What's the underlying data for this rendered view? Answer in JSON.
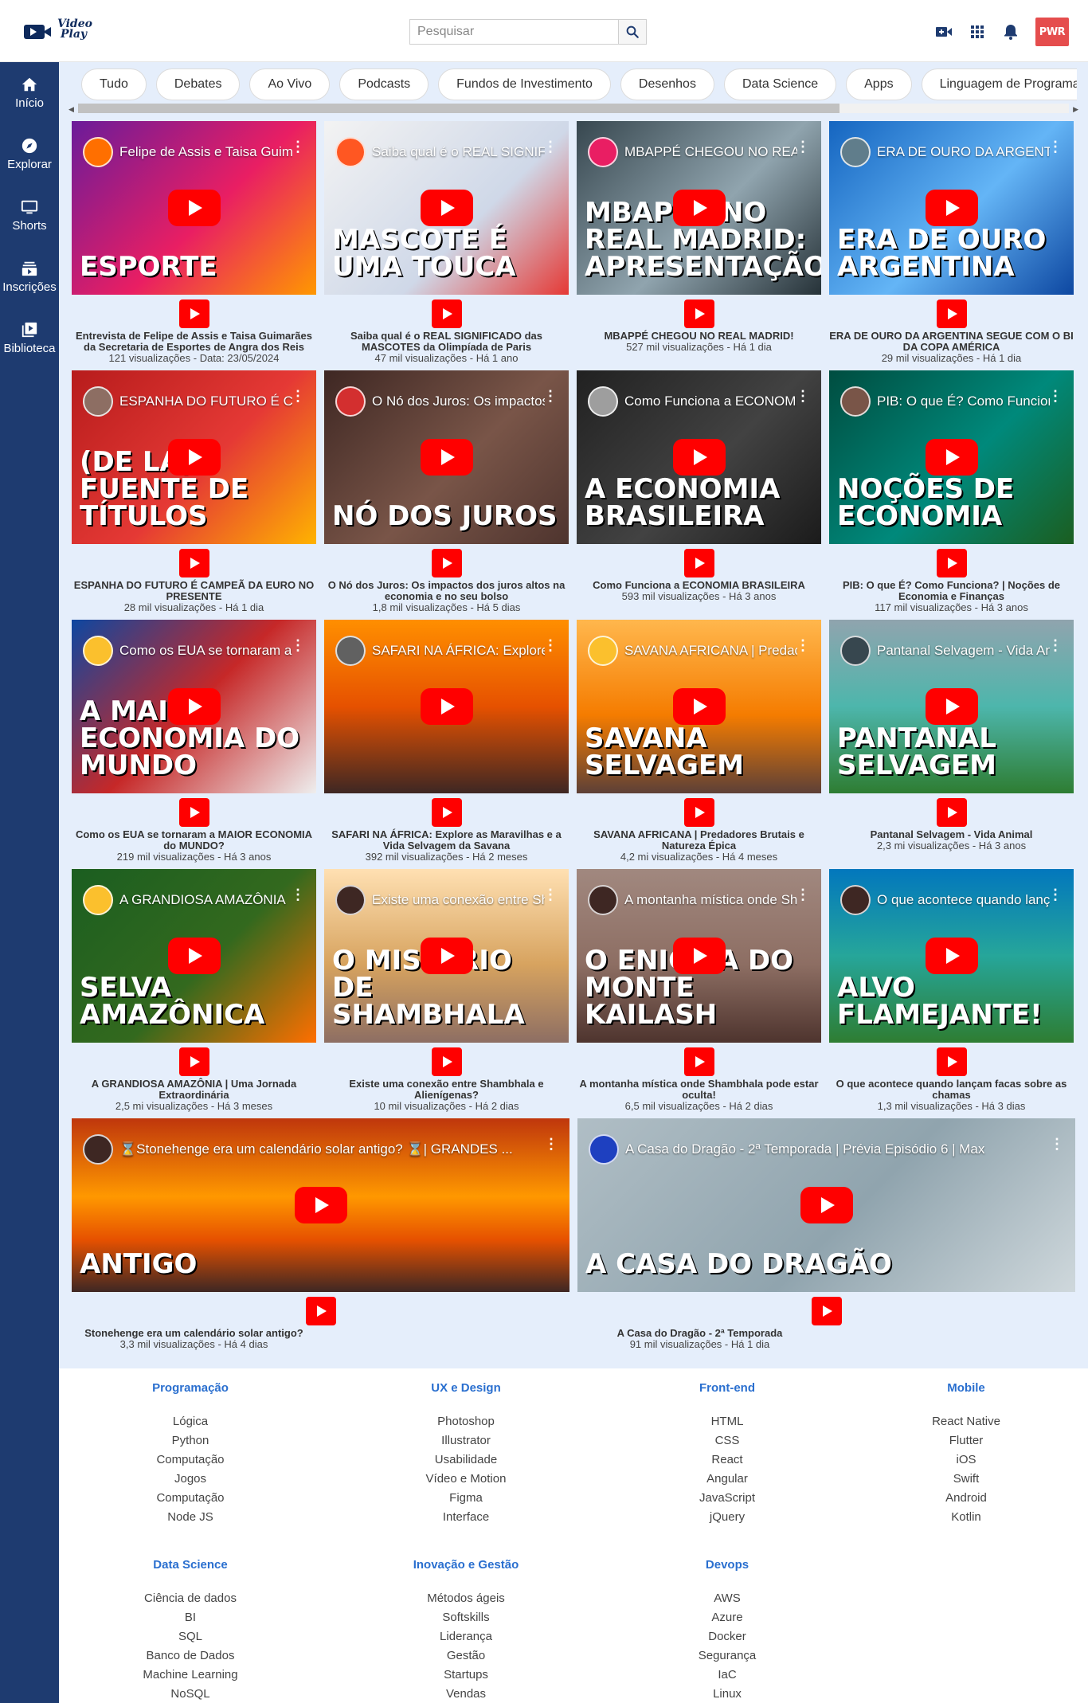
{
  "header": {
    "logo_line1": "Video",
    "logo_line2": "Play",
    "search_placeholder": "Pesquisar",
    "avatar_text": "PWR"
  },
  "sidebar": [
    {
      "label": "Início",
      "icon": "home-icon"
    },
    {
      "label": "Explorar",
      "icon": "compass-icon"
    },
    {
      "label": "Shorts",
      "icon": "shorts-icon"
    },
    {
      "label": "Inscrições",
      "icon": "subscriptions-icon"
    },
    {
      "label": "Biblioteca",
      "icon": "library-icon"
    }
  ],
  "chips": [
    "Tudo",
    "Debates",
    "Ao Vivo",
    "Podcasts",
    "Fundos de Investimento",
    "Desenhos",
    "Data Science",
    "Apps",
    "Linguagem de Programação"
  ],
  "videos": [
    {
      "thumb_title": "Felipe de Assis e Taisa Guimarães | Entrevista",
      "thumb_text": "ESPORTE",
      "title": "Entrevista de Felipe de Assis e Taisa Guimarães da Secretaria de Esportes de Angra dos Reis",
      "views": "121 visualizações - Data: 23/05/2024",
      "bg": "linear-gradient(135deg,#6a1b9a,#e91e63 55%,#ff9800)",
      "chan": "#ff6f00"
    },
    {
      "thumb_title": "Saiba qual é o REAL SIGNIFICADO",
      "thumb_text": "MASCOTE É UMA TOUCA",
      "title": "Saiba qual é o REAL SIGNIFICADO das MASCOTES da Olimpíada de Paris",
      "views": "47 mil visualizações - Há 1 ano",
      "bg": "linear-gradient(135deg,#f3f3f3,#cfd8e8 60%,#e53935)",
      "chan": "#ff5722"
    },
    {
      "thumb_title": "MBAPPÉ CHEGOU NO REAL MADRID!",
      "thumb_text": "MBAPPÉ NO REAL MADRID: APRESENTAÇÃO",
      "title": "MBAPPÉ CHEGOU NO REAL MADRID!",
      "views": "527 mil visualizações - Há 1 dia",
      "bg": "linear-gradient(135deg,#37474f,#90a4ae 55%,#263238)",
      "chan": "#e91e63"
    },
    {
      "thumb_title": "ERA DE OURO DA ARGENTINA",
      "thumb_text": "ERA DE OURO ARGENTINA",
      "title": "ERA DE OURO DA ARGENTINA SEGUE COM O BI DA COPA AMÉRICA",
      "views": "29 mil visualizações - Há 1 dia",
      "bg": "linear-gradient(135deg,#1565c0,#64b5f6 55%,#0d47a1)",
      "chan": "#607d8b"
    },
    {
      "thumb_title": "ESPANHA DO FUTURO É CAMPEÃ",
      "thumb_text": "(DE LA) FUENTE DE TÍTULOS",
      "title": "ESPANHA DO FUTURO É CAMPEÃ DA EURO NO PRESENTE",
      "views": "28 mil visualizações - Há 1 dia",
      "bg": "linear-gradient(135deg,#b71c1c,#e53935 55%,#ffb300)",
      "chan": "#8d6e63"
    },
    {
      "thumb_title": "O Nó dos Juros: Os impactos",
      "thumb_text": "NÓ DOS JUROS",
      "title": "O Nó dos Juros: Os impactos dos juros altos na economia e no seu bolso",
      "views": "1,8 mil visualizações - Há 5 dias",
      "bg": "linear-gradient(135deg,#3e2723,#795548 55%,#4e342e)",
      "chan": "#d32f2f"
    },
    {
      "thumb_title": "Como Funciona a ECONOMIA",
      "thumb_text": "A ECONOMIA BRASILEIRA",
      "title": "Como Funciona a ECONOMIA BRASILEIRA",
      "views": "593 mil visualizações - Há 3 anos",
      "bg": "linear-gradient(135deg,#212121,#424242 55%,#1b1b1b)",
      "chan": "#9e9e9e"
    },
    {
      "thumb_title": "PIB: O que É? Como Funciona?",
      "thumb_text": "NOÇÕES DE ECONOMIA",
      "title": "PIB: O que É? Como Funciona? | Noções de Economia e Finanças",
      "views": "117 mil visualizações - Há 3 anos",
      "bg": "linear-gradient(135deg,#004d40,#00897b 55%,#1b5e20)",
      "chan": "#795548"
    },
    {
      "thumb_title": "Como os EUA se tornaram a MAIOR",
      "thumb_text": "A MAIOR ECONOMIA DO MUNDO",
      "title": "Como os EUA se tornaram a MAIOR ECONOMIA do MUNDO?",
      "views": "219 mil visualizações - Há 3 anos",
      "bg": "linear-gradient(135deg,#0d47a1,#c62828 50%,#eeeeee)",
      "chan": "#fbc02d"
    },
    {
      "thumb_title": "SAFARI NA ÁFRICA: Explore",
      "thumb_text": "",
      "title": "SAFARI NA ÁFRICA: Explore as Maravilhas e a Vida Selvagem da Savana",
      "views": "392 mil visualizações - Há 2 meses",
      "bg": "linear-gradient(180deg,#ff8f00,#e65100 50%,#3e2723)",
      "chan": "#616161"
    },
    {
      "thumb_title": "SAVANA AFRICANA | Predadores",
      "thumb_text": "SAVANA SELVAGEM",
      "title": "SAVANA AFRICANA | Predadores Brutais e Natureza Épica",
      "views": "4,2 mi visualizações - Há 4 meses",
      "bg": "linear-gradient(180deg,#ffb74d,#f57c00 55%,#5d4037)",
      "chan": "#fbc02d"
    },
    {
      "thumb_title": "Pantanal Selvagem - Vida Animal",
      "thumb_text": "PANTANAL SELVAGEM",
      "title": "Pantanal Selvagem - Vida Animal",
      "views": "2,3 mi visualizações - Há 3 anos",
      "bg": "linear-gradient(180deg,#90a4ae,#4db6ac 50%,#2e7d32)",
      "chan": "#37474f"
    },
    {
      "thumb_title": "A GRANDIOSA AMAZÔNIA",
      "thumb_text": "SELVA AMAZÔNICA",
      "title": "A GRANDIOSA AMAZÔNIA | Uma Jornada Extraordinária",
      "views": "2,5 mi visualizações - Há 3 meses",
      "bg": "linear-gradient(135deg,#1b5e20,#33691e 55%,#ff6f00)",
      "chan": "#fbc02d"
    },
    {
      "thumb_title": "Existe uma conexão entre Shambhala",
      "thumb_text": "O MISTÉRIO DE SHAMBHALA",
      "title": "Existe uma conexão entre Shambhala e Alienígenas?",
      "views": "10 mil visualizações - Há 2 dias",
      "bg": "linear-gradient(180deg,#ffe0b2,#d7a35f 55%,#8d6e63)",
      "chan": "#3e2723"
    },
    {
      "thumb_title": "A montanha mística onde Shambhala",
      "thumb_text": "O ENIGMA DO MONTE KAILASH",
      "title": "A montanha mística onde Shambhala pode estar oculta!",
      "views": "6,5 mil visualizações - Há 2 dias",
      "bg": "linear-gradient(180deg,#a1887f,#8d6e63 55%,#4e342e)",
      "chan": "#3e2723"
    },
    {
      "thumb_title": "O que acontece quando lançam facas",
      "thumb_text": "ALVO FLAMEJANTE!",
      "title": "O que acontece quando lançam facas sobre as chamas",
      "views": "1,3 mil visualizações - Há 3 dias",
      "bg": "linear-gradient(180deg,#0277bd,#26a69a 50%,#2e7d32)",
      "chan": "#3e2723"
    }
  ],
  "wide_videos": [
    {
      "thumb_title": "⌛Stonehenge era um calendário solar antigo? ⌛| GRANDES ...",
      "thumb_text": "ANTIGO",
      "title": "Stonehenge era um calendário solar antigo?",
      "views": "3,3 mil visualizações - Há 4 dias",
      "bg": "linear-gradient(180deg,#bf360c,#ff9800 45%,#e65100 70%,#3e2723)",
      "chan": "#3e2723"
    },
    {
      "thumb_title": "A Casa do Dragão - 2ª Temporada | Prévia Episódio 6 | Max",
      "thumb_text": "A CASA DO DRAGÃO",
      "title": "A Casa do Dragão - 2ª Temporada",
      "views": "91 mil visualizações - Há 1 dia",
      "bg": "linear-gradient(135deg,#b0bec5,#90a4ae 55%,#cfd8dc)",
      "chan": "#1e40c0"
    }
  ],
  "footer": [
    {
      "heading": "Programação",
      "links": [
        "Lógica",
        "Python",
        "Computação",
        "Jogos",
        "Computação",
        "Node JS"
      ]
    },
    {
      "heading": "UX e Design",
      "links": [
        "Photoshop",
        "Illustrator",
        "Usabilidade",
        "Vídeo e Motion",
        "Figma",
        "Interface"
      ]
    },
    {
      "heading": "Front-end",
      "links": [
        "HTML",
        "CSS",
        "React",
        "Angular",
        "JavaScript",
        "jQuery"
      ]
    },
    {
      "heading": "Mobile",
      "links": [
        "React Native",
        "Flutter",
        "iOS",
        "Swift",
        "Android",
        "Kotlin"
      ]
    },
    {
      "heading": "Data Science",
      "links": [
        "Ciência de dados",
        "BI",
        "SQL",
        "Banco de Dados",
        "Machine Learning",
        "NoSQL"
      ]
    },
    {
      "heading": "Inovação e Gestão",
      "links": [
        "Métodos ágeis",
        "Softskills",
        "Liderança",
        "Gestão",
        "Startups",
        "Vendas"
      ]
    },
    {
      "heading": "Devops",
      "links": [
        "AWS",
        "Azure",
        "Docker",
        "Segurança",
        "IaC",
        "Linux"
      ]
    }
  ],
  "colors": {
    "sidebar": "#1e3b70",
    "content_bg": "#e5eefb",
    "accent": "#2a6fcf",
    "play_red": "#ff0000"
  }
}
